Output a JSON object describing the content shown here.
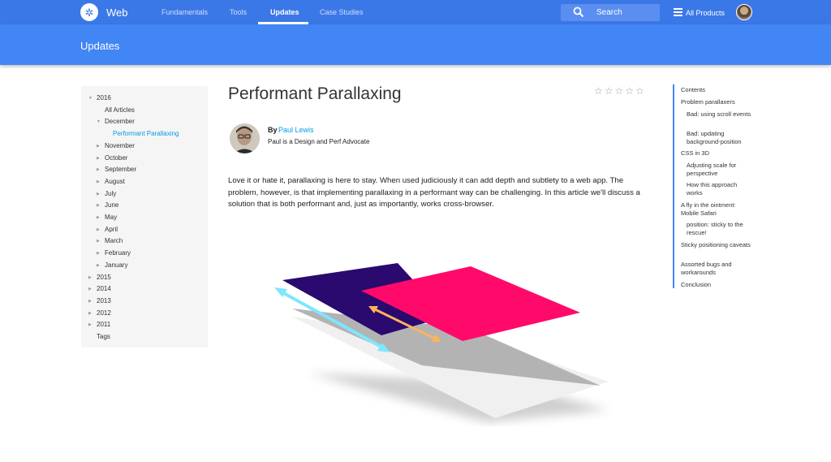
{
  "topbar": {
    "logo_glyph": "✲",
    "site_title": "Web",
    "nav": [
      "Fundamentals",
      "Tools",
      "Updates",
      "Case Studies"
    ],
    "active_nav": "Updates",
    "search_placeholder": "Search",
    "products_label": "All Products"
  },
  "header": {
    "title": "Updates"
  },
  "sidebar": {
    "years_expanded": "2016",
    "items": [
      {
        "label": "2016",
        "level": 0
      },
      {
        "label": "All Articles",
        "level": 1
      },
      {
        "label": "December",
        "level": 1
      },
      {
        "label": "Performant Parallaxing",
        "level": 2,
        "selected": true
      },
      {
        "label": "November",
        "level": 1
      },
      {
        "label": "October",
        "level": 1
      },
      {
        "label": "September",
        "level": 1
      },
      {
        "label": "August",
        "level": 1
      },
      {
        "label": "July",
        "level": 1
      },
      {
        "label": "June",
        "level": 1
      },
      {
        "label": "May",
        "level": 1
      },
      {
        "label": "April",
        "level": 1
      },
      {
        "label": "March",
        "level": 1
      },
      {
        "label": "February",
        "level": 1
      },
      {
        "label": "January",
        "level": 1
      },
      {
        "label": "2015",
        "level": 0
      },
      {
        "label": "2014",
        "level": 0
      },
      {
        "label": "2013",
        "level": 0
      },
      {
        "label": "2012",
        "level": 0
      },
      {
        "label": "2011",
        "level": 0
      },
      {
        "label": "Tags",
        "level": 0
      }
    ]
  },
  "article": {
    "title": "Performant Parallaxing",
    "rating_stars": [
      "☆",
      "☆",
      "☆",
      "☆",
      "☆"
    ],
    "author_by": "By",
    "author_name": "Paul Lewis",
    "author_desc": "Paul is a Design and Perf Advocate",
    "intro": "Love it or hate it, parallaxing is here to stay. When used judiciously it can add depth and subtlety to a web app. The problem, however, is that implementing parallaxing in a performant way can be challenging. In this article we'll discuss a solution that is both performant and, just as importantly, works cross-browser."
  },
  "toc": {
    "heading": "Contents",
    "items": [
      {
        "label": "Problem parallaxers",
        "level": 0
      },
      {
        "label": "Bad: using scroll events",
        "level": 1
      },
      {
        "label": "Bad: updating background-position",
        "level": 1
      },
      {
        "label": "CSS in 3D",
        "level": 0
      },
      {
        "label": "Adjusting scale for perspective",
        "level": 1
      },
      {
        "label": "How this approach works",
        "level": 1
      },
      {
        "label": "A fly in the ointment: Mobile Safari",
        "level": 0
      },
      {
        "label": "position: sticky to the rescue!",
        "level": 1
      },
      {
        "label": "Sticky positioning caveats",
        "level": 0
      },
      {
        "label": "Assorted bugs and workarounds",
        "level": 0
      },
      {
        "label": "Conclusion",
        "level": 0
      }
    ]
  },
  "colors": {
    "topbar": "#3b78e7",
    "header": "#4285f4",
    "link": "#039be5",
    "hero_navy": "#2a0a6e",
    "hero_pink": "#ff0a6a",
    "hero_cyan": "#7fe6ff",
    "hero_orange": "#ffb35c"
  }
}
